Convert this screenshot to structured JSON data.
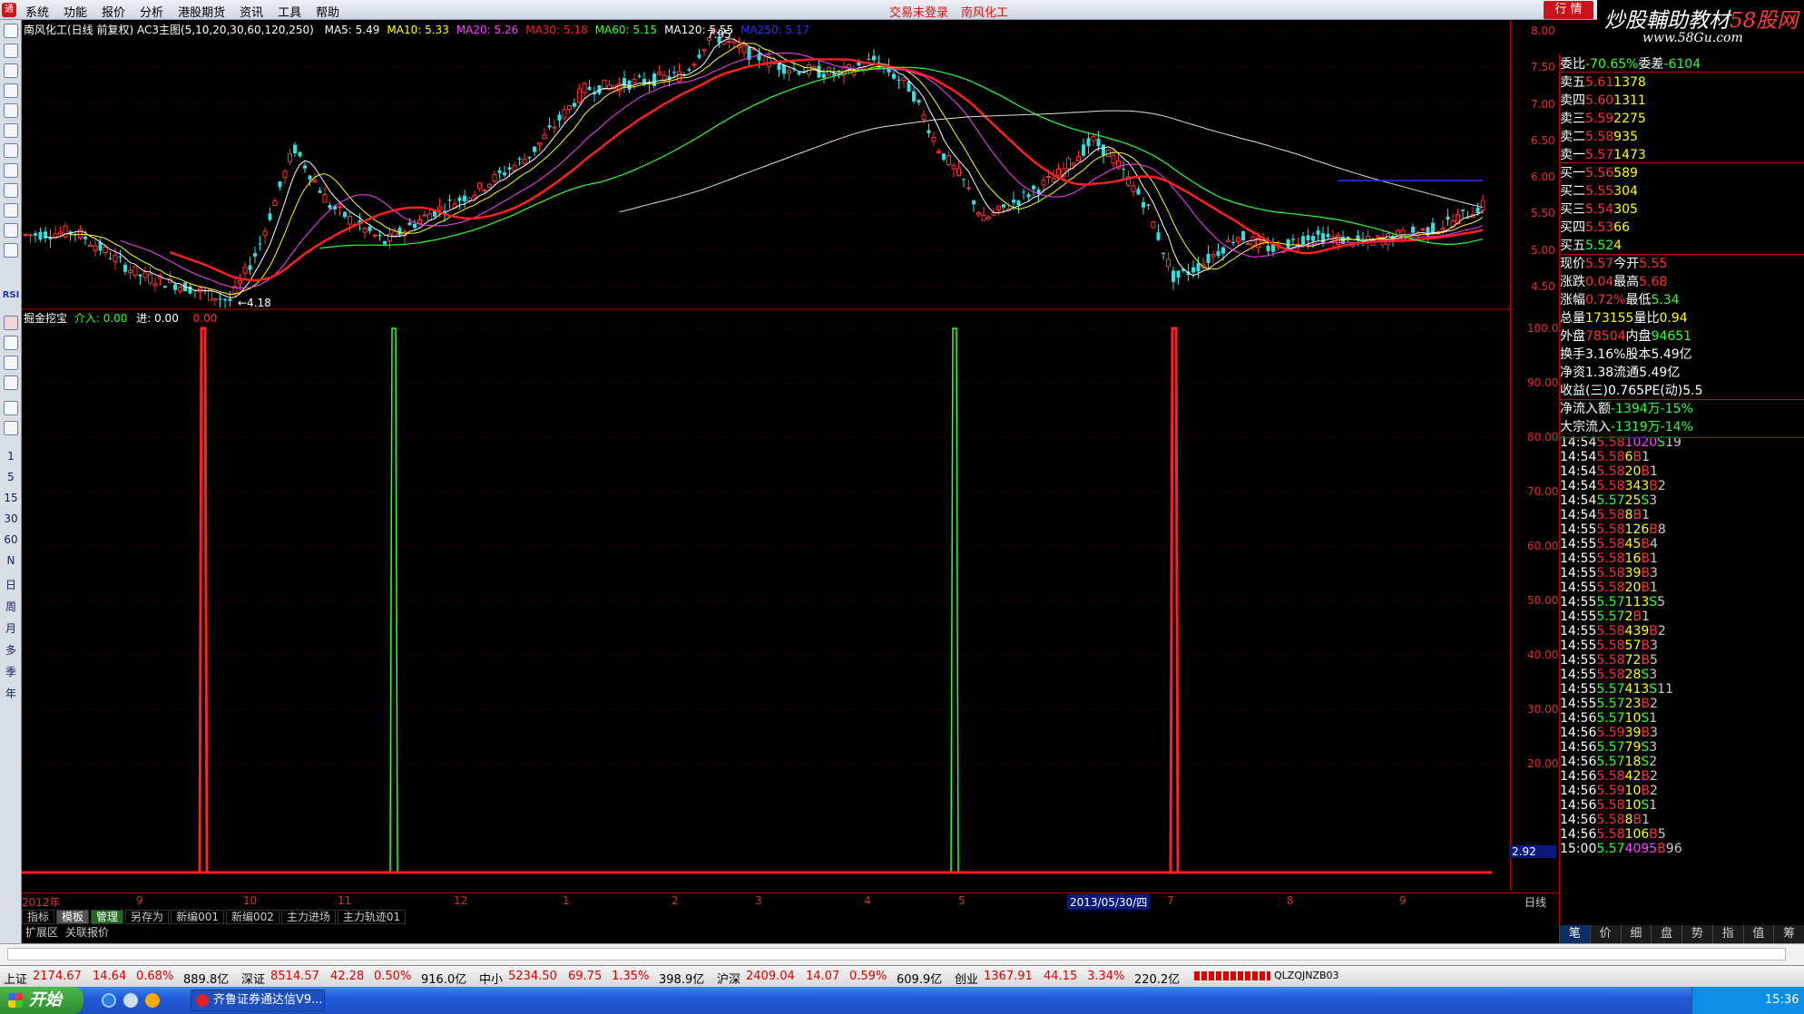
{
  "app": {
    "logo": "通",
    "menu": [
      "系统",
      "功能",
      "报价",
      "分析",
      "港股期货",
      "资讯",
      "工具",
      "帮助"
    ],
    "login_status": "交易未登录",
    "stock_title": "南风化工",
    "quote_button": "行 情"
  },
  "watermark": {
    "line1_a": "炒股輔助教材",
    "line1_b": "58股网",
    "line2": "www.58Gu.com"
  },
  "left_toolbar": {
    "labels": [
      "RSI",
      "1",
      "5",
      "15",
      "30",
      "60",
      "N",
      "日",
      "周",
      "月",
      "多",
      "季",
      "年"
    ]
  },
  "main_chart": {
    "header_name": "南风化工(日线 前复权) AC3主图(5,10,20,30,60,120,250)",
    "ma": [
      {
        "label": "MA5: 5.49",
        "color": "#ffffff"
      },
      {
        "label": "MA10: 5.33",
        "color": "#ffff00"
      },
      {
        "label": "MA20: 5.26",
        "color": "#ff40ff"
      },
      {
        "label": "MA30: 5.18",
        "color": "#ff2020"
      },
      {
        "label": "MA60: 5.15",
        "color": "#30ff30"
      },
      {
        "label": "MA120: 5.55",
        "color": "#ffffff"
      },
      {
        "label": "MA250: 5.17",
        "color": "#3030ff"
      }
    ],
    "price_ticks": [
      "8.00",
      "7.50",
      "7.00",
      "6.50",
      "6.00",
      "5.50",
      "5.00",
      "4.50"
    ],
    "price_range": [
      4.3,
      8.05
    ],
    "high_label": "7.95",
    "low_label": "4.18"
  },
  "sub_chart": {
    "name": "掘金挖宝",
    "l1": "介入: 0.00",
    "l2": "进: 0.00",
    "l3": "0.00",
    "ticks": [
      "100.0",
      "90.00",
      "80.00",
      "70.00",
      "60.00",
      "50.00",
      "40.00",
      "30.00",
      "20.00"
    ],
    "current_value": "2.92"
  },
  "chart_data": {
    "type": "line",
    "title": "掘金挖宝",
    "ylim": [
      0,
      100
    ],
    "signals": [
      {
        "series": "介入",
        "color": "#ff2020",
        "value": 100
      },
      {
        "series": "进",
        "color": "#30ff30",
        "value": 100
      },
      {
        "series": "进",
        "color": "#30ff30",
        "value": 100
      },
      {
        "series": "介入",
        "color": "#ff2020",
        "value": 100
      }
    ]
  },
  "x_axis": {
    "labels": [
      "2012年",
      "9",
      "10",
      "11",
      "12",
      "1",
      "2",
      "3",
      "4",
      "5",
      "2013/05/30/四",
      "7",
      "8",
      "9"
    ],
    "period": "日线"
  },
  "bottom_tabs": [
    "指标",
    "模板",
    "管理",
    "另存为",
    "新编001",
    "新编002",
    "主力进场",
    "主力轨迹01"
  ],
  "ext_tabs": [
    "扩展区",
    "关联报价"
  ],
  "quote": {
    "weibi": {
      "label": "委比",
      "value": "-70.65%",
      "label2": "委差",
      "value2": "-6104"
    },
    "sells": [
      {
        "label": "卖五",
        "price": "5.61",
        "vol": "1378"
      },
      {
        "label": "卖四",
        "price": "5.60",
        "vol": "1311"
      },
      {
        "label": "卖三",
        "price": "5.59",
        "vol": "2275"
      },
      {
        "label": "卖二",
        "price": "5.58",
        "vol": "935"
      },
      {
        "label": "卖一",
        "price": "5.57",
        "vol": "1473"
      }
    ],
    "buys": [
      {
        "label": "买一",
        "price": "5.56",
        "vol": "589"
      },
      {
        "label": "买二",
        "price": "5.55",
        "vol": "304"
      },
      {
        "label": "买三",
        "price": "5.54",
        "vol": "305"
      },
      {
        "label": "买四",
        "price": "5.53",
        "vol": "66"
      },
      {
        "label": "买五",
        "price": "5.52",
        "vol": "4"
      }
    ],
    "stats": [
      {
        "l1": "现价",
        "v1": "5.57",
        "l2": "今开",
        "v2": "5.55",
        "c1": "#ff3030",
        "c2": "#ff3030"
      },
      {
        "l1": "涨跌",
        "v1": "0.04",
        "l2": "最高",
        "v2": "5.68",
        "c1": "#ff3030",
        "c2": "#ff3030"
      },
      {
        "l1": "涨幅",
        "v1": "0.72%",
        "l2": "最低",
        "v2": "5.34",
        "c1": "#ff3030",
        "c2": "#30ff30"
      },
      {
        "l1": "总量",
        "v1": "173155",
        "l2": "量比",
        "v2": "0.94",
        "c1": "#ffff00",
        "c2": "#ffff00"
      },
      {
        "l1": "外盘",
        "v1": "78504",
        "l2": "内盘",
        "v2": "94651",
        "c1": "#ff3030",
        "c2": "#30ff30"
      },
      {
        "l1": "换手",
        "v1": "3.16%",
        "l2": "股本",
        "v2": "5.49亿",
        "c1": "#ffffff",
        "c2": "#ffffff"
      },
      {
        "l1": "净资",
        "v1": "1.38",
        "l2": "流通",
        "v2": "5.49亿",
        "c1": "#ffffff",
        "c2": "#ffffff"
      },
      {
        "l1": "收益(三)",
        "v1": "0.765",
        "l2": "PE(动)",
        "v2": "5.5",
        "c1": "#ffffff",
        "c2": "#ffffff"
      }
    ],
    "flows": [
      {
        "label": "净流入额",
        "v1": "-1394万",
        "v2": "-15%"
      },
      {
        "label": "大宗流入",
        "v1": "-1319万",
        "v2": "-14%"
      }
    ]
  },
  "ticks": [
    [
      "14:54",
      "5.58",
      "1020",
      "S",
      "19"
    ],
    [
      "14:54",
      "5.58",
      "6",
      "B",
      "1"
    ],
    [
      "14:54",
      "5.58",
      "20",
      "B",
      "1"
    ],
    [
      "14:54",
      "5.58",
      "343",
      "B",
      "2"
    ],
    [
      "14:54",
      "5.57",
      "25",
      "S",
      "3"
    ],
    [
      "14:54",
      "5.58",
      "8",
      "B",
      "1"
    ],
    [
      "14:55",
      "5.58",
      "126",
      "B",
      "8"
    ],
    [
      "14:55",
      "5.58",
      "45",
      "B",
      "4"
    ],
    [
      "14:55",
      "5.58",
      "16",
      "B",
      "1"
    ],
    [
      "14:55",
      "5.58",
      "39",
      "B",
      "3"
    ],
    [
      "14:55",
      "5.58",
      "20",
      "B",
      "1"
    ],
    [
      "14:55",
      "5.57",
      "113",
      "S",
      "5"
    ],
    [
      "14:55",
      "5.57",
      "2",
      "B",
      "1"
    ],
    [
      "14:55",
      "5.58",
      "439",
      "B",
      "2"
    ],
    [
      "14:55",
      "5.58",
      "57",
      "B",
      "3"
    ],
    [
      "14:55",
      "5.58",
      "72",
      "B",
      "5"
    ],
    [
      "14:55",
      "5.58",
      "28",
      "S",
      "3"
    ],
    [
      "14:55",
      "5.57",
      "413",
      "S",
      "11"
    ],
    [
      "14:55",
      "5.57",
      "23",
      "B",
      "2"
    ],
    [
      "14:56",
      "5.57",
      "10",
      "S",
      "1"
    ],
    [
      "14:56",
      "5.59",
      "39",
      "B",
      "3"
    ],
    [
      "14:56",
      "5.57",
      "79",
      "S",
      "3"
    ],
    [
      "14:56",
      "5.57",
      "18",
      "S",
      "2"
    ],
    [
      "14:56",
      "5.58",
      "42",
      "B",
      "2"
    ],
    [
      "14:56",
      "5.59",
      "10",
      "B",
      "2"
    ],
    [
      "14:56",
      "5.58",
      "10",
      "S",
      "1"
    ],
    [
      "14:56",
      "5.58",
      "8",
      "B",
      "1"
    ],
    [
      "14:56",
      "5.58",
      "106",
      "B",
      "5"
    ],
    [
      "15:00",
      "5.57",
      "4095",
      "B",
      "96"
    ]
  ],
  "right_tabs": [
    "笔",
    "价",
    "细",
    "盘",
    "势",
    "指",
    "值",
    "筹"
  ],
  "status_bar": {
    "items": [
      {
        "name": "上证",
        "v1": "2174.67",
        "v2": "14.64",
        "v3": "0.68%",
        "amt": "889.8亿"
      },
      {
        "name": "深证",
        "v1": "8514.57",
        "v2": "42.28",
        "v3": "0.50%",
        "amt": "916.0亿"
      },
      {
        "name": "中小",
        "v1": "5234.50",
        "v2": "69.75",
        "v3": "1.35%",
        "amt": "398.9亿"
      },
      {
        "name": "沪深",
        "v1": "2409.04",
        "v2": "14.07",
        "v3": "0.59%",
        "amt": "609.9亿"
      },
      {
        "name": "创业",
        "v1": "1367.91",
        "v2": "44.15",
        "v3": "3.34%",
        "amt": "220.2亿"
      }
    ],
    "code": "QLZQJNZB03"
  },
  "taskbar": {
    "start": "开始",
    "app_item": "齐鲁证券通达信V9....",
    "clock": "15:36"
  }
}
